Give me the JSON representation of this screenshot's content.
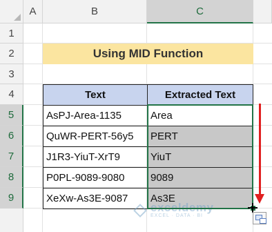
{
  "columns": [
    "A",
    "B",
    "C"
  ],
  "rows": [
    "1",
    "2",
    "3",
    "4",
    "5",
    "6",
    "7",
    "8",
    "9"
  ],
  "title": "Using MID Function",
  "table": {
    "headers": [
      "Text",
      "Extracted Text"
    ],
    "rows": [
      [
        "AsPJ-Area-1135",
        "Area"
      ],
      [
        "QuWR-PERT-56y5",
        "PERT"
      ],
      [
        "J1R3-YiuT-XrT9",
        "YiuT"
      ],
      [
        "P0PL-9089-9080",
        "9089"
      ],
      [
        "XeXw-As3E-9087",
        "As3E"
      ]
    ]
  },
  "watermark": {
    "main": "exceldemy",
    "sub": "EXCEL · DATA · BI"
  },
  "selection": {
    "range": "C5:C9",
    "color": "#217346"
  },
  "arrow_color": "#e02020",
  "title_fill": "#fbe5a0",
  "header_fill": "#c8d4ee"
}
